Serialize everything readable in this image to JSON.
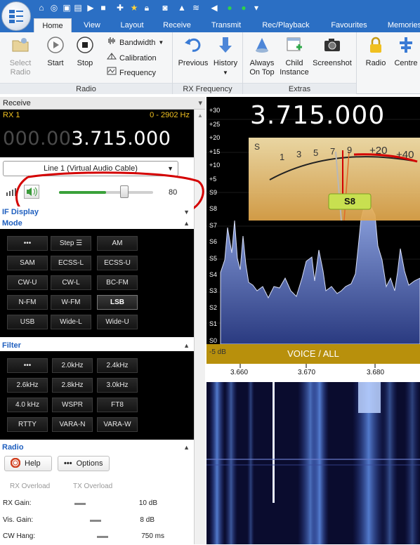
{
  "tabs": [
    "Home",
    "View",
    "Layout",
    "Receive",
    "Transmit",
    "Rec/Playback",
    "Favourites",
    "Memories"
  ],
  "ribbon": {
    "select_radio": [
      "Select",
      "Radio"
    ],
    "start": "Start",
    "stop": "Stop",
    "bandwidth": "Bandwidth",
    "calibration": "Calibration",
    "frequency": "Frequency",
    "group_radio": "Radio",
    "previous": "Previous",
    "history": "History",
    "group_rx_frequency": "RX Frequency",
    "always_on_top": [
      "Always",
      "On Top"
    ],
    "child_instance": [
      "Child",
      "Instance"
    ],
    "screenshot": "Screenshot",
    "group_extras": "Extras",
    "radio_btn": "Radio",
    "centre_btn": "Centre"
  },
  "receive": {
    "title": "Receive",
    "rx_label": "RX 1",
    "bandwidth_readout": "0 - 2902 Hz",
    "freq_dim": "000.00",
    "freq_bright": "3.715.000",
    "audio_device": "Line 1 (Virtual Audio Cable)",
    "volume_value": "80",
    "volume_level": 0.8
  },
  "if_display_label": "IF Display",
  "mode": {
    "label": "Mode",
    "buttons": [
      "•••",
      "Step ☰",
      "AM",
      "SAM",
      "ECSS-L",
      "ECSS-U",
      "CW-U",
      "CW-L",
      "BC-FM",
      "N-FM",
      "W-FM",
      "LSB",
      "USB",
      "Wide-L",
      "Wide-U"
    ],
    "selected": "LSB"
  },
  "filter": {
    "label": "Filter",
    "buttons": [
      "•••",
      "2.0kHz",
      "2.4kHz",
      "2.6kHz",
      "2.8kHz",
      "3.0kHz",
      "4.0 kHz",
      "WSPR",
      "FT8",
      "RTTY",
      "VARA-N",
      "VARA-W"
    ]
  },
  "radio": {
    "label": "Radio",
    "help": "Help",
    "options": "Options",
    "rx_overload": "RX Overload",
    "tx_overload": "TX Overload",
    "rows": [
      {
        "label": "RX Gain:",
        "value": "10 dB"
      },
      {
        "label": "Vis. Gain:",
        "value": "8 dB"
      },
      {
        "label": "CW Hang:",
        "value": "750 ms"
      }
    ]
  },
  "spectrum": {
    "frequency": "3.715.000",
    "db_scale": [
      "+30",
      "+25",
      "+20",
      "+15",
      "+10",
      "+5",
      "S9",
      "S8",
      "S7",
      "S6",
      "S5",
      "S4",
      "S3",
      "S2",
      "S1",
      "S0"
    ],
    "bottom_db": "-5 dB",
    "meter_scale": [
      "S",
      "1",
      "3",
      "5",
      "7",
      "9",
      "+20",
      "+40"
    ],
    "s_reading": "S8",
    "band_label": "VOICE / ALL",
    "freq_ticks": [
      "3.660",
      "3.670",
      "3.680"
    ]
  },
  "colors": {
    "title_bar": "#2b6fc4",
    "accent_blue": "#1f5fbf",
    "annotation_red": "#d40000",
    "readout_yellow": "#f0c020"
  }
}
